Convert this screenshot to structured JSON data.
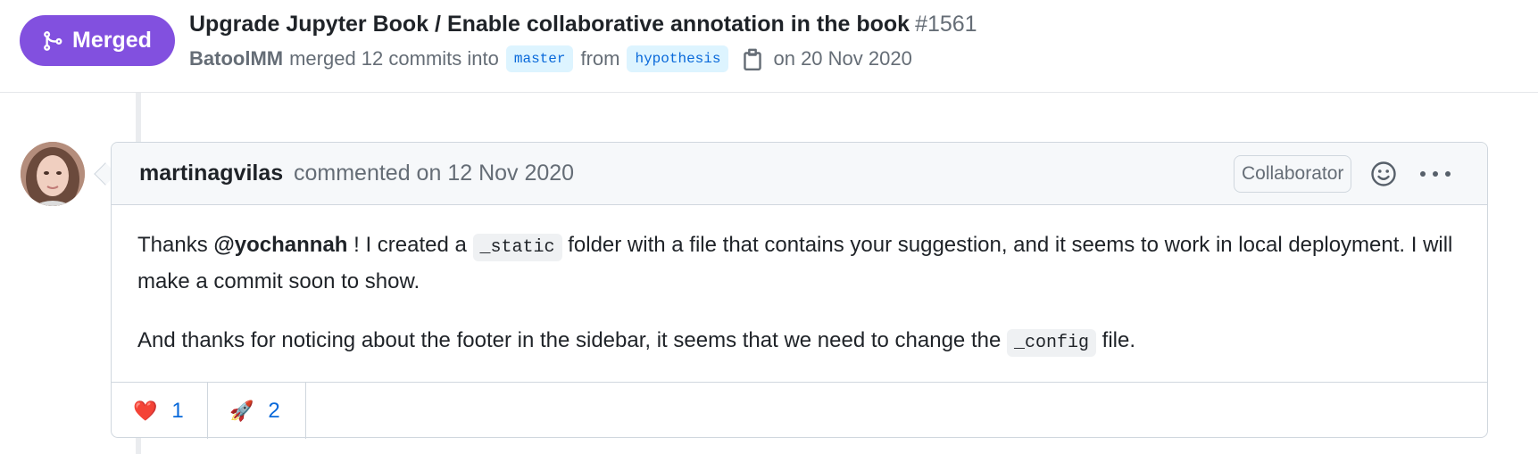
{
  "pr": {
    "status": "Merged",
    "title": "Upgrade Jupyter Book / Enable collaborative annotation in the book",
    "number": "#1561",
    "author": "BatoolMM",
    "merged_text": "merged 12 commits into",
    "base_branch": "master",
    "from_text": "from",
    "head_branch": "hypothesis",
    "date_text": "on 20 Nov 2020"
  },
  "comment": {
    "author": "martinagvilas",
    "date": "commented on 12 Nov 2020",
    "role": "Collaborator",
    "body": {
      "p1_pre": "Thanks ",
      "p1_mention": "@yochannah",
      "p1_mid": " ! I created a ",
      "p1_code": "_static",
      "p1_post": " folder with a file that contains your suggestion, and it seems to work in local deployment. I will make a commit soon to show.",
      "p2_pre": "And thanks for noticing about the footer in the sidebar, it seems that we need to change the ",
      "p2_code": "_config",
      "p2_post": " file."
    },
    "reactions": [
      {
        "emoji": "❤️",
        "icon": "heart",
        "count": "1"
      },
      {
        "emoji": "🚀",
        "icon": "rocket",
        "count": "2"
      }
    ]
  },
  "colors": {
    "merged": "#8250df",
    "link": "#0969da",
    "muted": "#656d76"
  }
}
